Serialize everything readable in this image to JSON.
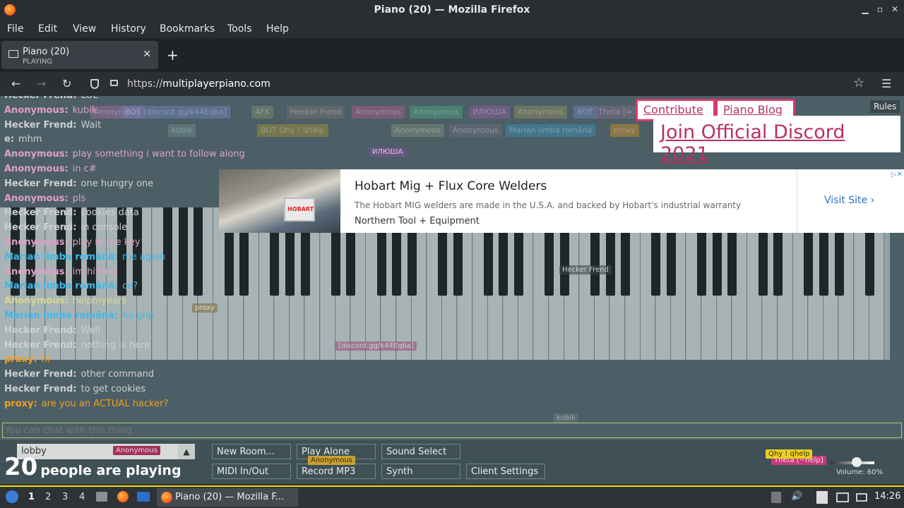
{
  "window": {
    "title": "Piano (20) — Mozilla Firefox",
    "min_icon": "▁",
    "max_icon": "▫",
    "close_icon": "✕"
  },
  "menu": [
    "File",
    "Edit",
    "View",
    "History",
    "Bookmarks",
    "Tools",
    "Help"
  ],
  "tab": {
    "title": "Piano (20)",
    "subtitle": "PLAYING",
    "close": "✕"
  },
  "new_tab": "+",
  "nav": {
    "back": "←",
    "forward": "→",
    "reload": "↻",
    "url_prefix": "https://",
    "url_domain": "multiplayerpiano.com",
    "star": "☆",
    "menu": "☰"
  },
  "participants": [
    {
      "name": "Anonymous",
      "color": "#9a6a9a"
    },
    {
      "name": "BOT [discord.gg/k44Eqba]",
      "color": "#6a7fb5"
    },
    {
      "name": "AFK",
      "color": "#7a8a6a"
    },
    {
      "name": "Hecker Frend",
      "color": "#707070"
    },
    {
      "name": "Anonymous",
      "color": "#a05a8a"
    },
    {
      "name": "Anonymous",
      "color": "#4a9a7a"
    },
    {
      "name": "ИЛЮША",
      "color": "#8a5a9a"
    },
    {
      "name": "Anonymous",
      "color": "#8a8a5a"
    },
    {
      "name": "BOT",
      "color": "#6a7fb5"
    },
    {
      "name": "Theta [=",
      "color": "#7a6a8a"
    },
    {
      "name": "kubik",
      "color": "#6a8a8a"
    },
    {
      "name": "BOT Qhy ! qhelp",
      "color": "#9a8a3a"
    },
    {
      "name": "Anonymous",
      "color": "#7a8a7a"
    },
    {
      "name": "Anonymous",
      "color": "#6a6a7a"
    },
    {
      "name": "Marian limba română",
      "color": "#3a8aaa"
    },
    {
      "name": "proxy",
      "color": "#c08a2a"
    }
  ],
  "chat": [
    {
      "who": "Hecker Frend:",
      "msg": "LOL",
      "color": "#d0d0d0"
    },
    {
      "who": "Anonymous:",
      "msg": "kubik",
      "color": "#e0a0c8"
    },
    {
      "who": "Hecker Frend:",
      "msg": "Wait",
      "color": "#d0d0d0"
    },
    {
      "who": "e:",
      "msg": "mhm",
      "color": "#d0d0d0"
    },
    {
      "who": "Anonymous:",
      "msg": "play something i want to follow along",
      "color": "#e0a0c8"
    },
    {
      "who": "Anonymous:",
      "msg": "in c#",
      "color": "#e0a0c8"
    },
    {
      "who": "Hecker Frend:",
      "msg": "one hungry one",
      "color": "#d0d0d0"
    },
    {
      "who": "Anonymous:",
      "msg": "pls",
      "color": "#e0a0c8"
    },
    {
      "who": "Hecker Frend:",
      "msg": "cookies data",
      "color": "#d0d0d0"
    },
    {
      "who": "Hecker Frend:",
      "msg": "in console",
      "color": "#d0d0d0"
    },
    {
      "who": "Anonymous:",
      "msg": "play in the key",
      "color": "#e0a0c8"
    },
    {
      "who": "Marian limba română:",
      "msg": "me again",
      "color": "#40b8e8"
    },
    {
      "who": "Anonymous:",
      "msg": "im hitting",
      "color": "#e0a0c8"
    },
    {
      "who": "Marian limba română:",
      "msg": "ce?",
      "color": "#40b8e8"
    },
    {
      "who": "Anonymous:",
      "msg": "helpmyears",
      "color": "#d8d890"
    },
    {
      "who": "Marian limba română:",
      "msg": "ho ghp",
      "color": "#40b8e8"
    },
    {
      "who": "Hecker Frend:",
      "msg": "Well",
      "color": "#d0d0d0"
    },
    {
      "who": "Hecker Frend:",
      "msg": "nothing is here",
      "color": "#d0d0d0"
    },
    {
      "who": "proxy:",
      "msg": "hi",
      "color": "#f0a020"
    },
    {
      "who": "Hecker Frend:",
      "msg": "other command",
      "color": "#d0d0d0"
    },
    {
      "who": "Hecker Frend:",
      "msg": "to get cookies",
      "color": "#d0d0d0"
    },
    {
      "who": "proxy:",
      "msg": "are you an ACTUAL hacker?",
      "color": "#f0a020"
    }
  ],
  "links": {
    "contribute": "Contribute",
    "blog": "Piano Blog",
    "discord": "Join Official Discord 2021",
    "rules": "Rules"
  },
  "ad": {
    "title": "Hobart Mig + Flux Core Welders",
    "desc": "The Hobart MIG welders are made in the U.S.A. and backed by Hobart's industrial warranty",
    "brand": "Northern Tool + Equipment",
    "cta": "Visit Site ›",
    "logo": "HOBART",
    "close": "▷✕"
  },
  "chat_input": {
    "placeholder": "You can chat with this thing."
  },
  "room": {
    "value": "lobby",
    "arrow": "▲"
  },
  "count": {
    "num": "20",
    "label": "people are playing"
  },
  "buttons": {
    "new_room": "New Room...",
    "play_alone": "Play Alone",
    "sound_select": "Sound Select",
    "midi": "MIDI In/Out",
    "record": "Record MP3",
    "synth": "Synth",
    "client_settings": "Client Settings"
  },
  "cursor_tags": {
    "anon1": "Anonymous",
    "anon2": "Anonymous",
    "qhy": "Qhy ! qhelp",
    "theta": "Theta [~help]",
    "hecker": "Hecker Frend",
    "ilyusha": "ИЛЮША",
    "discord": "[discord.gg/k44Eqba]",
    "proxy": "proxy",
    "kubik": "kubik"
  },
  "volume": {
    "label": "Volume: 60%",
    "level": 0.6
  },
  "taskbar": {
    "workspaces": [
      "1",
      "2",
      "3",
      "4"
    ],
    "app_title": "Piano (20) — Mozilla F...",
    "clock": "14:26"
  }
}
